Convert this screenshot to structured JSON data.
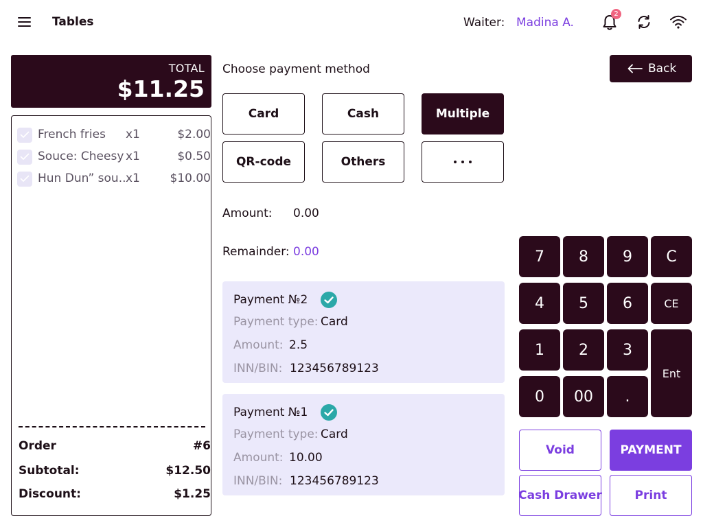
{
  "header": {
    "title": "Tables",
    "waiter_label": "Waiter:",
    "waiter_name": "Madina A.",
    "notification_count": "2"
  },
  "total": {
    "label": "TOTAL",
    "value": "$11.25"
  },
  "receipt": {
    "items": [
      {
        "name": "French fries",
        "qty": "x1",
        "price": "$2.00"
      },
      {
        "name": "Souce: Cheesy",
        "qty": "x1",
        "price": "$0.50"
      },
      {
        "name": "Hun Dun” sou..",
        "qty": "x1",
        "price": "$10.00"
      }
    ],
    "order_label": "Order",
    "order_value": "#6",
    "subtotal_label": "Subtotal:",
    "subtotal_value": "$12.50",
    "discount_label": "Discount:",
    "discount_value": "$1.25"
  },
  "payment_methods": {
    "title": "Choose payment method",
    "options": [
      "Card",
      "Cash",
      "Multiple",
      "QR-code",
      "Others"
    ],
    "selected": "Multiple"
  },
  "back_label": "Back",
  "amount": {
    "label": "Amount:",
    "value": "0.00"
  },
  "remainder": {
    "label": "Remainder:",
    "value": "0.00"
  },
  "payments": [
    {
      "title": "Payment №2",
      "type_label": "Payment type:",
      "type_value": "Card",
      "amount_label": "Amount:",
      "amount_value": "2.5",
      "inn_label": "INN/BIN:",
      "inn_value": "123456789123"
    },
    {
      "title": "Payment №1",
      "type_label": "Payment type:",
      "type_value": "Card",
      "amount_label": "Amount:",
      "amount_value": "10.00",
      "inn_label": "INN/BIN:",
      "inn_value": "123456789123"
    }
  ],
  "keypad": {
    "keys": [
      "7",
      "8",
      "9",
      "C",
      "4",
      "5",
      "6",
      "CE",
      "1",
      "2",
      "3",
      "Ent",
      "0",
      "00",
      "."
    ]
  },
  "actions": {
    "void": "Void",
    "payment": "PAYMENT",
    "cash_drawer": "Cash Drawer",
    "print": "Print"
  },
  "colors": {
    "dark": "#2b0a1b",
    "accent": "#7b3ee0",
    "card_bg": "#ebe9fb",
    "check_teal": "#2ba8a8",
    "badge": "#f06480"
  }
}
